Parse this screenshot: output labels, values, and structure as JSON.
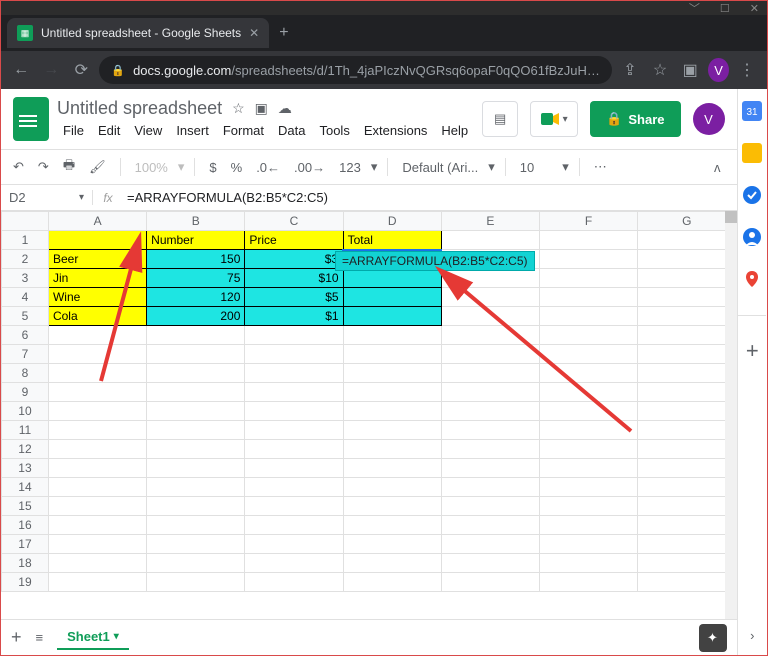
{
  "browser": {
    "tab_title": "Untitled spreadsheet - Google Sheets",
    "url_host": "docs.google.com",
    "url_path": "/spreadsheets/d/1Th_4jaPIczNvQGRsq6opaF0qQO61fBzJuH…",
    "profile_letter": "V"
  },
  "doc": {
    "title": "Untitled spreadsheet",
    "menus": [
      "File",
      "Edit",
      "View",
      "Insert",
      "Format",
      "Data",
      "Tools",
      "Extensions",
      "Help"
    ],
    "share_label": "Share",
    "avatar_letter": "V"
  },
  "toolbar": {
    "zoom": "100%",
    "currency": "$",
    "percent": "%",
    "dec_less": ".0",
    "dec_more": ".00",
    "format_num": "123",
    "font": "Default (Ari...",
    "font_size": "10",
    "more": "⋯"
  },
  "formula": {
    "namebox": "D2",
    "formula_text": "=ARRAYFORMULA(B2:B5*C2:C5)"
  },
  "columns": [
    "A",
    "B",
    "C",
    "D",
    "E",
    "F",
    "G"
  ],
  "rows": 19,
  "headers": {
    "A": "",
    "B": "Number",
    "C": "Price",
    "D": "Total"
  },
  "items": [
    {
      "name": "Beer",
      "number": "150",
      "price": "$3"
    },
    {
      "name": "Jin",
      "number": "75",
      "price": "$10"
    },
    {
      "name": "Wine",
      "number": "120",
      "price": "$5"
    },
    {
      "name": "Cola",
      "number": "200",
      "price": "$1"
    }
  ],
  "tooltip_text": "=ARRAYFORMULA(B2:B5*C2:C5)",
  "sheet": {
    "name": "Sheet1"
  },
  "icons": {
    "calendar_color": "#4285f4",
    "keep_color": "#fbbc04",
    "tasks_color": "#1a73e8",
    "contacts_color": "#1a73e8",
    "maps_color": "#ea4335"
  }
}
